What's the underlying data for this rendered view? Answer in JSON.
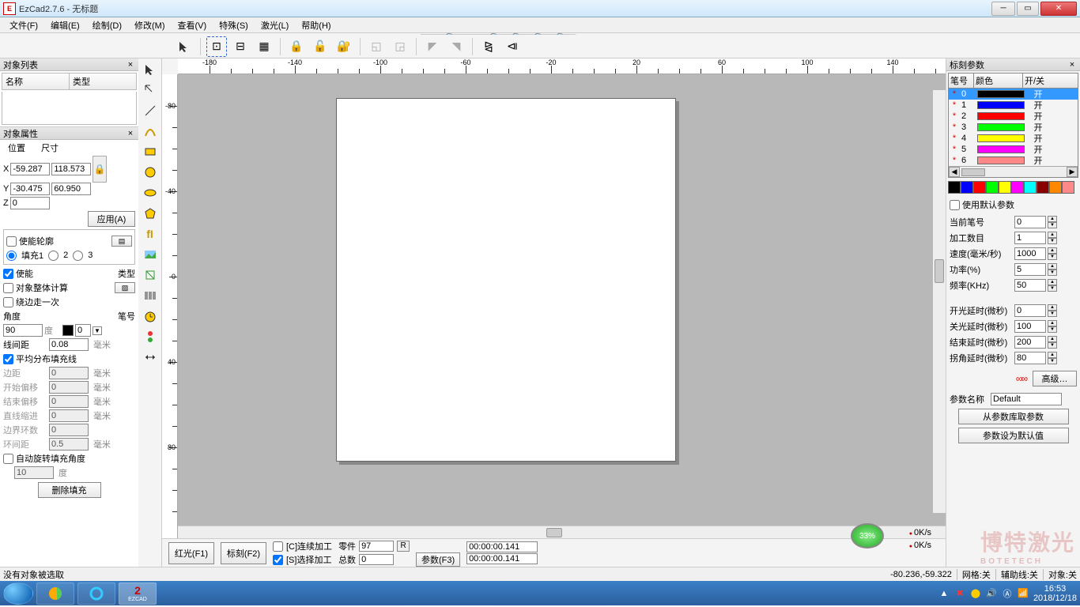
{
  "title": "EzCad2.7.6 - 无标题",
  "menu": [
    "文件(F)",
    "编辑(E)",
    "绘制(D)",
    "修改(M)",
    "查看(V)",
    "特殊(S)",
    "激光(L)",
    "帮助(H)"
  ],
  "objlist": {
    "title": "对象列表",
    "cols": [
      "名称",
      "类型"
    ]
  },
  "props": {
    "title": "对象属性",
    "pos_label": "位置",
    "size_label": "尺寸",
    "x": "-59.287",
    "w": "118.573",
    "y": "-30.475",
    "h": "60.950",
    "z": "0",
    "apply": "应用(A)",
    "enable_outline": "使能轮廓",
    "fill1": "填充1",
    "fill2": "2",
    "fill3": "3",
    "enable": "使能",
    "type_label": "类型",
    "object_whole": "对象整体计算",
    "around_once": "绕边走一次",
    "angle_label": "角度",
    "pen_label": "笔号",
    "angle": "90",
    "deg": "度",
    "pen": "0",
    "line_space_label": "线间距",
    "line_space": "0.08",
    "mm": "毫米",
    "avg_fill": "平均分布填充线",
    "margin_label": "边距",
    "margin": "0",
    "start_offset_label": "开始偏移",
    "start_offset": "0",
    "end_offset_label": "结束偏移",
    "end_offset": "0",
    "line_reduce_label": "直线缩进",
    "line_reduce": "0",
    "boundary_loops_label": "边界环数",
    "boundary_loops": "0",
    "ring_space_label": "环间距",
    "ring_space": "0.5",
    "auto_rotate": "自动旋转填充角度",
    "auto_rotate_val": "10",
    "delete_fill": "删除填充"
  },
  "right": {
    "title": "标刻参数",
    "pen_head": [
      "笔号",
      "颜色",
      "开/关"
    ],
    "pens": [
      {
        "n": "0",
        "c": "#000000",
        "on": "开",
        "sel": true
      },
      {
        "n": "1",
        "c": "#0000ff",
        "on": "开"
      },
      {
        "n": "2",
        "c": "#ff0000",
        "on": "开"
      },
      {
        "n": "3",
        "c": "#00ff00",
        "on": "开"
      },
      {
        "n": "4",
        "c": "#ffff00",
        "on": "开"
      },
      {
        "n": "5",
        "c": "#ff00ff",
        "on": "开"
      },
      {
        "n": "6",
        "c": "#ff8888",
        "on": "开"
      }
    ],
    "swatches": [
      "#000",
      "#00f",
      "#f00",
      "#0f0",
      "#ff0",
      "#f0f",
      "#0ff",
      "#800",
      "#f80",
      "#f88"
    ],
    "use_default": "使用默认参数",
    "cur_pen_label": "当前笔号",
    "cur_pen": "0",
    "count_label": "加工数目",
    "count": "1",
    "speed_label": "速度(毫米/秒)",
    "speed": "1000",
    "power_label": "功率(%)",
    "power": "5",
    "freq_label": "频率(KHz)",
    "freq": "50",
    "on_delay_label": "开光延时(微秒)",
    "on_delay": "0",
    "off_delay_label": "关光延时(微秒)",
    "off_delay": "100",
    "end_delay_label": "结束延时(微秒)",
    "end_delay": "200",
    "corner_delay_label": "拐角延时(微秒)",
    "corner_delay": "80",
    "advanced": "高级…",
    "param_name_label": "参数名称",
    "param_name": "Default",
    "load_param": "从参数库取参数",
    "set_default": "参数设为默认值"
  },
  "bottom": {
    "red": "红光(F1)",
    "mark": "标刻(F2)",
    "continuous": "[C]连续加工",
    "select": "[S]选择加工",
    "parts_label": "零件",
    "parts": "97",
    "r": "R",
    "total_label": "总数",
    "total": "0",
    "param_btn": "参数(F3)",
    "time1": "00:00:00.141",
    "time2": "00:00:00.141",
    "gauge": "33%",
    "sp1": "0K/s",
    "sp2": "0K/s"
  },
  "status": {
    "msg": "没有对象被选取",
    "coords": "-80.236,-59.322",
    "grid": "网格:关",
    "guide": "辅助线:关",
    "obj": "对象:关"
  },
  "taskbar": {
    "app": "EZCAD",
    "time": "16:53",
    "date": "2018/12/18"
  },
  "ruler_h": [
    "-180",
    "-140",
    "-100",
    "-60",
    "-20",
    "20",
    "60",
    "100",
    "140"
  ],
  "ruler_v": [
    "-80",
    "-40",
    "0",
    "40",
    "80"
  ]
}
